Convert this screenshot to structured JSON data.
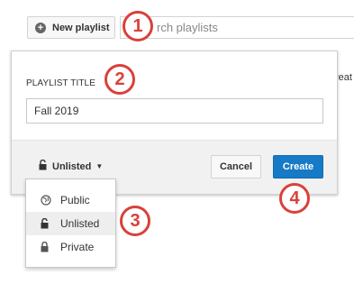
{
  "topbar": {
    "new_playlist_label": "New playlist",
    "search_placeholder_visible": "rch playlists",
    "background_partial_text": "reat"
  },
  "dialog": {
    "title_label": "PLAYLIST TITLE",
    "title_value": "Fall 2019",
    "privacy_selected": "Unlisted",
    "cancel_label": "Cancel",
    "create_label": "Create"
  },
  "privacy_menu": {
    "items": [
      {
        "label": "Public",
        "icon": "globe-icon",
        "selected": false
      },
      {
        "label": "Unlisted",
        "icon": "unlock-icon",
        "selected": true
      },
      {
        "label": "Private",
        "icon": "lock-icon",
        "selected": false
      }
    ]
  },
  "annotations": {
    "badges": [
      "1",
      "2",
      "3",
      "4"
    ]
  },
  "colors": {
    "primary_button": "#167ac6",
    "annotation_red": "#d9413a",
    "footer_bg": "#f1f1f1"
  }
}
